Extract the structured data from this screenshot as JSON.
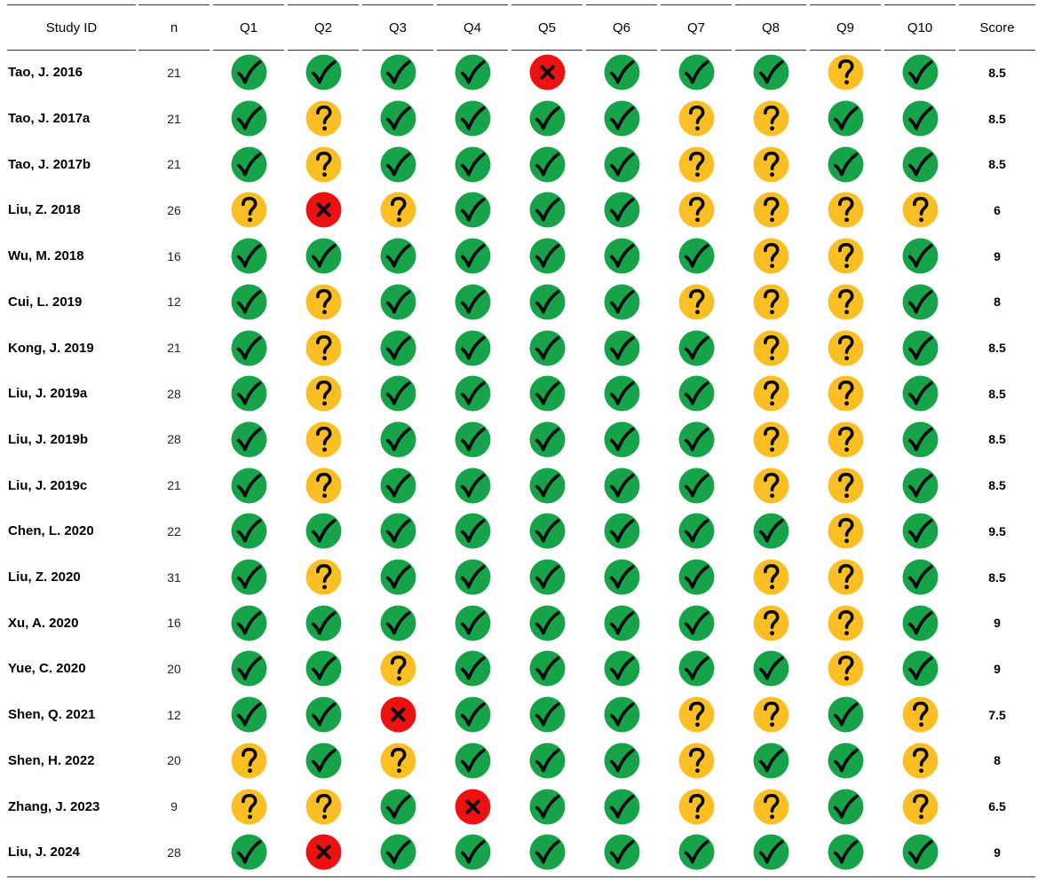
{
  "table": {
    "headers": [
      "Study ID",
      "n",
      "Q1",
      "Q2",
      "Q3",
      "Q4",
      "Q5",
      "Q6",
      "Q7",
      "Q8",
      "Q9",
      "Q10",
      "Score"
    ],
    "legend_icons": {
      "yes": {
        "icon": "green-check-icon",
        "color": "#16a34a"
      },
      "unclear": {
        "icon": "yellow-question-icon",
        "color": "#fbbf24"
      },
      "no": {
        "icon": "red-x-icon",
        "color": "#ee1111"
      }
    },
    "rows": [
      {
        "study": "Tao, J. 2016",
        "n": "21",
        "ratings": [
          "yes",
          "yes",
          "yes",
          "yes",
          "no",
          "yes",
          "yes",
          "yes",
          "unclear",
          "yes"
        ],
        "score": "8.5"
      },
      {
        "study": "Tao, J. 2017a",
        "n": "21",
        "ratings": [
          "yes",
          "unclear",
          "yes",
          "yes",
          "yes",
          "yes",
          "unclear",
          "unclear",
          "yes",
          "yes"
        ],
        "score": "8.5"
      },
      {
        "study": "Tao, J. 2017b",
        "n": "21",
        "ratings": [
          "yes",
          "unclear",
          "yes",
          "yes",
          "yes",
          "yes",
          "unclear",
          "unclear",
          "yes",
          "yes"
        ],
        "score": "8.5"
      },
      {
        "study": "Liu, Z. 2018",
        "n": "26",
        "ratings": [
          "unclear",
          "no",
          "unclear",
          "yes",
          "yes",
          "yes",
          "unclear",
          "unclear",
          "unclear",
          "unclear"
        ],
        "score": "6"
      },
      {
        "study": "Wu, M. 2018",
        "n": "16",
        "ratings": [
          "yes",
          "yes",
          "yes",
          "yes",
          "yes",
          "yes",
          "yes",
          "unclear",
          "unclear",
          "yes"
        ],
        "score": "9"
      },
      {
        "study": "Cui, L. 2019",
        "n": "12",
        "ratings": [
          "yes",
          "unclear",
          "yes",
          "yes",
          "yes",
          "yes",
          "unclear",
          "unclear",
          "unclear",
          "yes"
        ],
        "score": "8"
      },
      {
        "study": "Kong, J. 2019",
        "n": "21",
        "ratings": [
          "yes",
          "unclear",
          "yes",
          "yes",
          "yes",
          "yes",
          "yes",
          "unclear",
          "unclear",
          "yes"
        ],
        "score": "8.5"
      },
      {
        "study": "Liu, J. 2019a",
        "n": "28",
        "ratings": [
          "yes",
          "unclear",
          "yes",
          "yes",
          "yes",
          "yes",
          "yes",
          "unclear",
          "unclear",
          "yes"
        ],
        "score": "8.5"
      },
      {
        "study": "Liu, J. 2019b",
        "n": "28",
        "ratings": [
          "yes",
          "unclear",
          "yes",
          "yes",
          "yes",
          "yes",
          "yes",
          "unclear",
          "unclear",
          "yes"
        ],
        "score": "8.5"
      },
      {
        "study": "Liu, J. 2019c",
        "n": "21",
        "ratings": [
          "yes",
          "unclear",
          "yes",
          "yes",
          "yes",
          "yes",
          "yes",
          "unclear",
          "unclear",
          "yes"
        ],
        "score": "8.5"
      },
      {
        "study": "Chen, L. 2020",
        "n": "22",
        "ratings": [
          "yes",
          "yes",
          "yes",
          "yes",
          "yes",
          "yes",
          "yes",
          "yes",
          "unclear",
          "yes"
        ],
        "score": "9.5"
      },
      {
        "study": "Liu, Z. 2020",
        "n": "31",
        "ratings": [
          "yes",
          "unclear",
          "yes",
          "yes",
          "yes",
          "yes",
          "yes",
          "unclear",
          "unclear",
          "yes"
        ],
        "score": "8.5"
      },
      {
        "study": "Xu, A. 2020",
        "n": "16",
        "ratings": [
          "yes",
          "yes",
          "yes",
          "yes",
          "yes",
          "yes",
          "yes",
          "unclear",
          "unclear",
          "yes"
        ],
        "score": "9"
      },
      {
        "study": "Yue, C. 2020",
        "n": "20",
        "ratings": [
          "yes",
          "yes",
          "unclear",
          "yes",
          "yes",
          "yes",
          "yes",
          "yes",
          "unclear",
          "yes"
        ],
        "score": "9"
      },
      {
        "study": "Shen, Q. 2021",
        "n": "12",
        "ratings": [
          "yes",
          "yes",
          "no",
          "yes",
          "yes",
          "yes",
          "unclear",
          "unclear",
          "yes",
          "unclear"
        ],
        "score": "7.5"
      },
      {
        "study": "Shen, H. 2022",
        "n": "20",
        "ratings": [
          "unclear",
          "yes",
          "unclear",
          "yes",
          "yes",
          "yes",
          "unclear",
          "yes",
          "yes",
          "unclear"
        ],
        "score": "8"
      },
      {
        "study": "Zhang, J. 2023",
        "n": "9",
        "ratings": [
          "unclear",
          "unclear",
          "yes",
          "no",
          "yes",
          "yes",
          "unclear",
          "unclear",
          "yes",
          "unclear"
        ],
        "score": "6.5"
      },
      {
        "study": "Liu, J. 2024",
        "n": "28",
        "ratings": [
          "yes",
          "no",
          "yes",
          "yes",
          "yes",
          "yes",
          "yes",
          "yes",
          "yes",
          "yes"
        ],
        "score": "9"
      }
    ]
  }
}
